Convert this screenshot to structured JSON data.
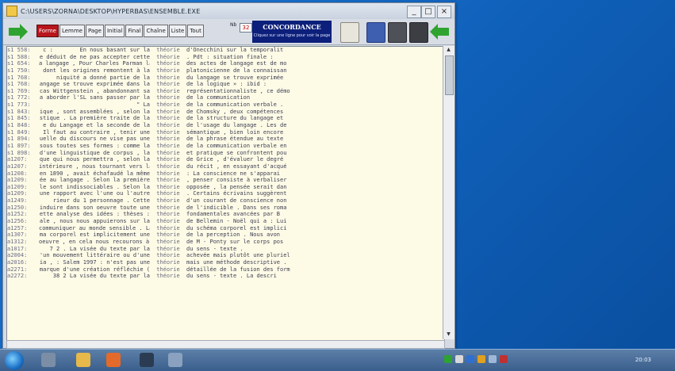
{
  "window": {
    "title": "C:\\USERS\\ZORNA\\DESKTOP\\HYPERBAS\\ENSEMBLE.EXE",
    "min_label": "_",
    "max_label": "□",
    "close_label": "×"
  },
  "toolbar": {
    "modes": [
      "Forme",
      "Lemme",
      "Page",
      "Initial",
      "Final",
      "Chaîne",
      "Liste",
      "Tout"
    ],
    "active_mode": "Forme",
    "nb_label": "Nb",
    "nb_value": "32",
    "concordance_title": "CONCORDANCE",
    "concordance_hint": "Cliquez sur une ligne pour voir la page"
  },
  "concordance": {
    "keyword": "théorie",
    "rows": [
      {
        "ref": "s1 558:",
        "left": "c :        En nous basant sur la",
        "right": "d'Onecchini sur la temporalit"
      },
      {
        "ref": "s1 588:",
        "left": "e déduit de ne pas accepter cette",
        "right": ". Pdt : situation finale :"
      },
      {
        "ref": "s1 654:",
        "left": "a langage , Pour Charles Parman la",
        "right": "des actes de langage est de mo"
      },
      {
        "ref": "s1 750:",
        "left": "dont les origines remontent à la",
        "right": "platonicienne de la connaissan"
      },
      {
        "ref": "s1 768:",
        "left": "niquité a donné partie de la",
        "right": "du langage se trouve exprimée"
      },
      {
        "ref": "s1 768:",
        "left": "angage se trouve exprimée dans la",
        "right": "de la logique » : ibid :"
      },
      {
        "ref": "s1 769:",
        "left": "cas Wittgenstein , abandonnant sa",
        "right": "représentationnaliste , ce démo"
      },
      {
        "ref": "s1 772:",
        "left": "a aborder l'SL sans passer par la",
        "right": "de la communication"
      },
      {
        "ref": "s1 773:",
        "left": "\" La",
        "right": "de la communication verbale ."
      },
      {
        "ref": "s1 843:",
        "left": "ique , sont assemblées , selon la",
        "right": "de Chomsky , deux compétences"
      },
      {
        "ref": "s1 845:",
        "left": "stique . La première traite de la",
        "right": "de la structure du langage et"
      },
      {
        "ref": "s1 848:",
        "left": "e du Langage et la seconde de la",
        "right": "de l'usage du langage . Les de"
      },
      {
        "ref": "s1 849:",
        "left": "Il faut au contraire , tenir une",
        "right": "sémantique , bien loin encore"
      },
      {
        "ref": "s1 894:",
        "left": "uelle du discours ne vise pas une",
        "right": "de la phrase étendue au texte"
      },
      {
        "ref": "s1 897:",
        "left": "sous toutes ses formes : comme la",
        "right": "de la communication verbale en"
      },
      {
        "ref": "s1 898:",
        "left": "d'une linguistique de corpus , la",
        "right": "et pratique se confrontent pou"
      },
      {
        "ref": "a1207:",
        "left": "que qui nous permettra , selon la",
        "right": "de Grice , d'évaluer le degré"
      },
      {
        "ref": "a1207:",
        "left": "intérieure , nous tournant vers la",
        "right": "du récit , en essayant d'acqué"
      },
      {
        "ref": "a1208:",
        "left": "en 1890 , avait échafaudé la même",
        "right": ": La conscience ne s'apparai"
      },
      {
        "ref": "a1209:",
        "left": "ée au langage . Selon la première",
        "right": ", penser consiste à verbaliser"
      },
      {
        "ref": "a1209:",
        "left": "le sont indissociables . Selon la",
        "right": "opposée , la pensée serait dan"
      },
      {
        "ref": "a1209:",
        "left": "une rapport avec l'une ou l'autre",
        "right": ". Certains écrivains suggèrent"
      },
      {
        "ref": "a1249:",
        "left": "rieur du 1 personnage . Cette",
        "right": "d'un courant de conscience non"
      },
      {
        "ref": "a1250:",
        "left": "induire dans son oeuvre toute une",
        "right": "de l'indicible . Dans ses roma"
      },
      {
        "ref": "a1252:",
        "left": "ette analyse des idées : thèses :",
        "right": "fondamentales avancées par B"
      },
      {
        "ref": "a1256:",
        "left": "ale , nous nous appuierons sur la",
        "right": "de Bellemin - Noël qui a : Lui"
      },
      {
        "ref": "a1257:",
        "left": "communiquer au monde sensible . La",
        "right": "du schéma corporel est implici"
      },
      {
        "ref": "a1307:",
        "left": "ma corporel est implicitement une",
        "right": "de la perception . Nous avon"
      },
      {
        "ref": "a1312:",
        "left": "oeuvre , en cela nous recourons à la",
        "right": "de M - Ponty sur le corps pos"
      },
      {
        "ref": "a1017:",
        "left": "7 2 . La visée du texte par la",
        "right": "du sens - texte ."
      },
      {
        "ref": "a2004:",
        "left": "'un mouvement littéraire ou d'une",
        "right": "achevée mais plutôt une pluriel"
      },
      {
        "ref": "a2016:",
        "left": "ia , : Salem 1997 : n'est pas une",
        "right": "mais une méthode descriptive ."
      },
      {
        "ref": "a2271:",
        "left": "marque d'une création réfléchie (",
        "right": "détaillée de la fusion des form"
      },
      {
        "ref": "a2272:",
        "left": "38 2 La visée du texte par la",
        "right": "du sens - texte . La descri"
      }
    ]
  },
  "taskbar": {
    "clock": "20:03"
  },
  "colors": {
    "active_mode": "#b8151c",
    "concordance_header": "#0c1f7a",
    "panel_background": "#fdfbe6",
    "desktop": "#1b6fc4"
  }
}
